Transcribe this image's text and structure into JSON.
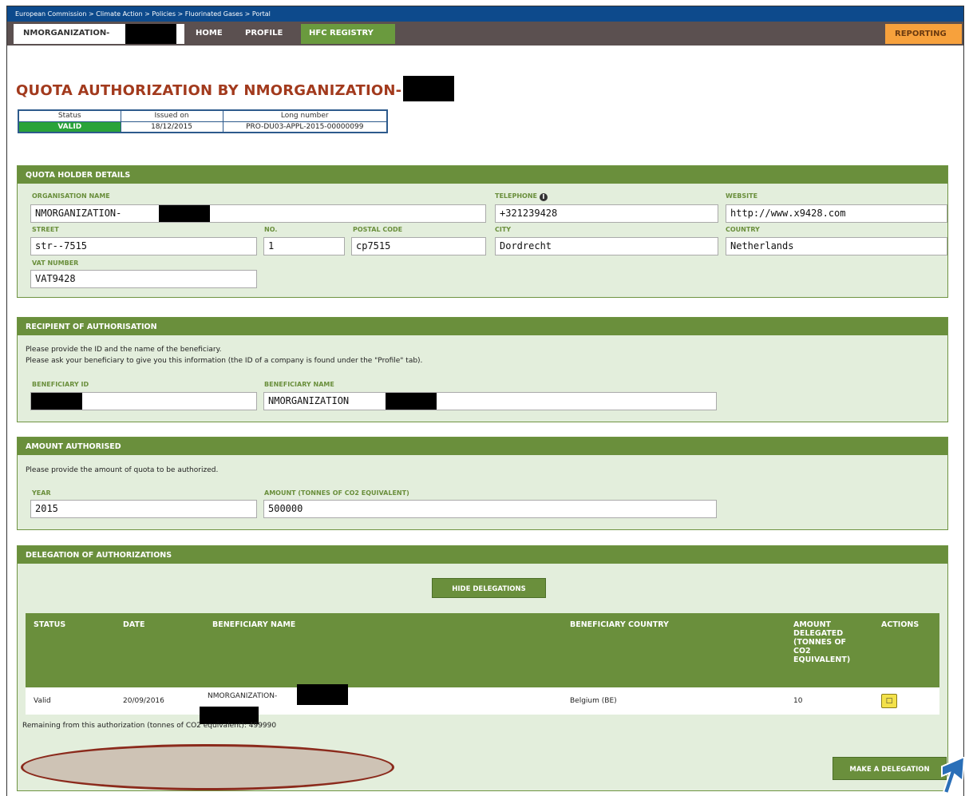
{
  "breadcrumb": "European Commission > Climate Action > Policies > Fluorinated Gases > Portal",
  "nav": {
    "org": "NMORGANIZATION-",
    "home": "HOME",
    "profile": "PROFILE",
    "hfc": "HFC REGISTRY",
    "reporting": "REPORTING"
  },
  "title": "QUOTA AUTHORIZATION BY NMORGANIZATION-",
  "status": {
    "h_status": "Status",
    "h_issued": "Issued on",
    "h_long": "Long number",
    "status": "VALID",
    "issued": "18/12/2015",
    "long": "PRO-DU03-APPL-2015-00000099",
    "status_color": "#2aa339"
  },
  "holder": {
    "title": "QUOTA HOLDER DETAILS",
    "org_label": "ORGANISATION NAME",
    "org_value": "NMORGANIZATION-",
    "tel_label": "TELEPHONE",
    "tel_value": "+321239428",
    "web_label": "WEBSITE",
    "web_value": "http://www.x9428.com",
    "street_label": "STREET",
    "street_value": "str--7515",
    "no_label": "NO.",
    "no_value": "1",
    "postal_label": "POSTAL CODE",
    "postal_value": "cp7515",
    "city_label": "CITY",
    "city_value": "Dordrecht",
    "country_label": "COUNTRY",
    "country_value": "Netherlands",
    "vat_label": "VAT NUMBER",
    "vat_value": "VAT9428"
  },
  "recipient": {
    "title": "RECIPIENT OF AUTHORISATION",
    "line1": "Please provide the ID and the name of the beneficiary.",
    "line2": "Please ask your beneficiary to give you this information (the ID of a company is found under the \"Profile\" tab).",
    "id_label": "BENEFICIARY ID",
    "name_label": "BENEFICIARY NAME",
    "name_value": "NMORGANIZATION"
  },
  "amount": {
    "title": "AMOUNT AUTHORISED",
    "line": "Please provide the amount of quota to be authorized.",
    "year_label": "YEAR",
    "year_value": "2015",
    "amount_label": "AMOUNT (TONNES OF CO2 EQUIVALENT)",
    "amount_value": "500000"
  },
  "delegation": {
    "title": "DELEGATION OF AUTHORIZATIONS",
    "hide_btn": "HIDE DELEGATIONS",
    "cols": {
      "status": "STATUS",
      "date": "DATE",
      "name": "BENEFICIARY NAME",
      "country": "BENEFICIARY COUNTRY",
      "amount": "AMOUNT DELEGATED (TONNES OF CO2 EQUIVALENT)",
      "actions": "ACTIONS"
    },
    "rows": [
      {
        "status": "Valid",
        "date": "20/09/2016",
        "name": "NMORGANIZATION-",
        "country": "Belgium (BE)",
        "amount": "10"
      }
    ],
    "remaining": "Remaining from this authorization (tonnes of CO2 equivalent): 499990",
    "make_btn": "MAKE A DELEGATION"
  },
  "colors": {
    "header_blue": "#0d4a8c",
    "nav_gray": "#5b5050",
    "green": "#6a8f3c",
    "reporting": "#f7a13c",
    "title_red": "#a23a1d"
  }
}
